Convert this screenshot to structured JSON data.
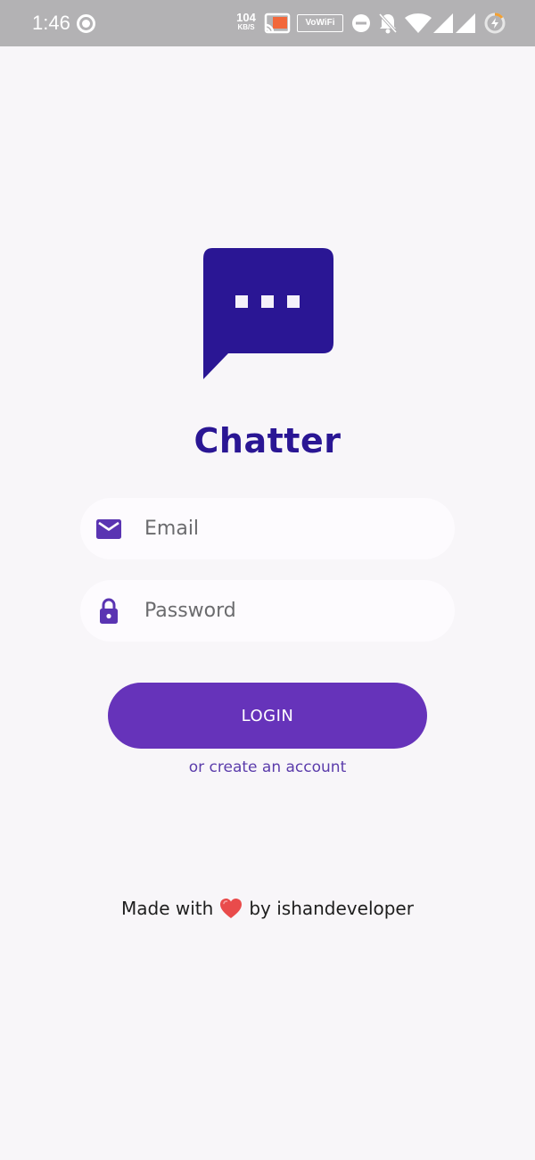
{
  "status_bar": {
    "time": "1:46",
    "net_speed": "104",
    "net_unit": "KB/S",
    "vowifi": "VoWiFi",
    "icons": [
      "record-icon",
      "cast-icon",
      "vowifi-icon",
      "dnd-icon",
      "bell-off-icon",
      "wifi-icon",
      "signal-icon",
      "signal-icon-2",
      "battery-charging-icon"
    ]
  },
  "app": {
    "title": "Chatter",
    "logo_icon": "chat-bubble-icon",
    "brand_color": "#2a1694"
  },
  "form": {
    "email": {
      "placeholder": "Email",
      "icon": "mail-icon"
    },
    "password": {
      "placeholder": "Password",
      "icon": "lock-icon"
    },
    "login_label": "LOGIN",
    "create_account_label": "or create an account",
    "accent_color": "#6633ba"
  },
  "footer": {
    "made_with": "Made with",
    "heart_icon": "heart-icon",
    "by": "by ishandeveloper"
  }
}
